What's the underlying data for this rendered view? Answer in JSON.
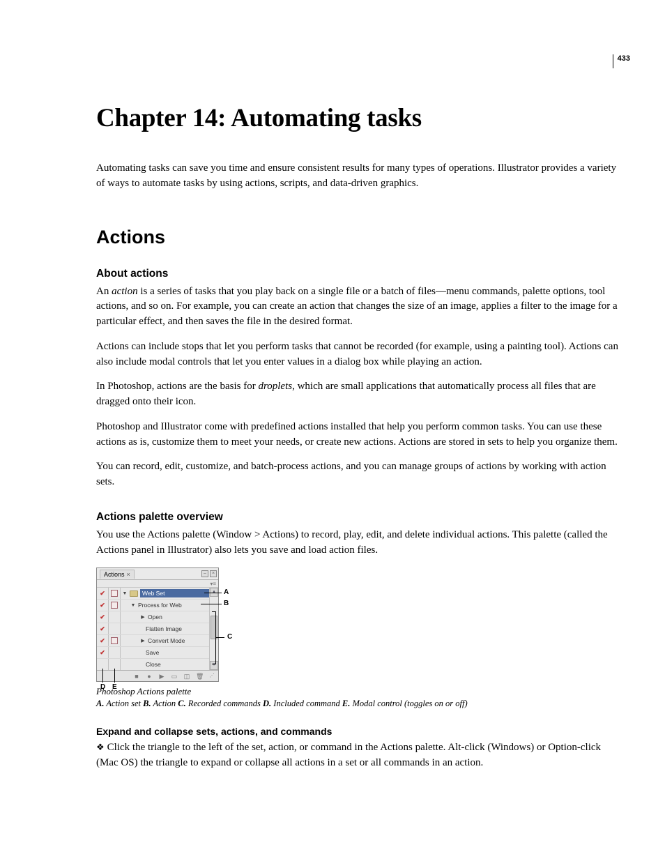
{
  "page_number": "433",
  "chapter_title": "Chapter 14: Automating tasks",
  "intro": "Automating tasks can save you time and ensure consistent results for many types of operations. Illustrator provides a variety of ways to automate tasks by using actions, scripts, and data-driven graphics.",
  "section_h2": "Actions",
  "sub1_h3": "About actions",
  "sub1_p1a": "An ",
  "sub1_p1_em": "action",
  "sub1_p1b": " is a series of tasks that you play back on a single file or a batch of files—menu commands, palette options, tool actions, and so on. For example, you can create an action that changes the size of an image, applies a filter to the image for a particular effect, and then saves the file in the desired format.",
  "sub1_p2": "Actions can include stops that let you perform tasks that cannot be recorded (for example, using a painting tool). Actions can also include modal controls that let you enter values in a dialog box while playing an action.",
  "sub1_p3a": "In Photoshop, actions are the basis for ",
  "sub1_p3_em": "droplets",
  "sub1_p3b": ", which are small applications that automatically process all files that are dragged onto their icon.",
  "sub1_p4": "Photoshop and Illustrator come with predefined actions installed that help you perform common tasks. You can use these actions as is, customize them to meet your needs, or create new actions. Actions are stored in sets to help you organize them.",
  "sub1_p5": "You can record, edit, customize, and batch-process actions, and you can manage groups of actions by working with action sets.",
  "sub2_h3": "Actions palette overview",
  "sub2_p1": "You use the Actions palette (Window > Actions) to record, play, edit, and delete individual actions. This palette (called the Actions panel in Illustrator) also lets you save and load action files.",
  "palette": {
    "tab_label": "Actions",
    "set_label": "Web Set",
    "action_label": "Process for Web",
    "cmd_open": "Open",
    "cmd_flatten": "Flatten Image",
    "cmd_convert": "Convert Mode",
    "cmd_save": "Save",
    "cmd_close": "Close"
  },
  "annot": {
    "A": "A",
    "B": "B",
    "C": "C",
    "D": "D",
    "E": "E"
  },
  "caption": "Photoshop Actions palette",
  "legend_a_b": "A.",
  "legend_a_t": " Action set  ",
  "legend_b_b": "B.",
  "legend_b_t": " Action  ",
  "legend_c_b": "C.",
  "legend_c_t": " Recorded commands  ",
  "legend_d_b": "D.",
  "legend_d_t": " Included command  ",
  "legend_e_b": "E.",
  "legend_e_t": " Modal control (toggles on or off)",
  "sub3_h4": "Expand and collapse sets, actions, and commands",
  "sub3_p1": "Click the triangle to the left of the set, action, or command in the Actions palette. Alt-click (Windows) or Option-click (Mac OS) the triangle to expand or collapse all actions in a set or all commands in an action."
}
